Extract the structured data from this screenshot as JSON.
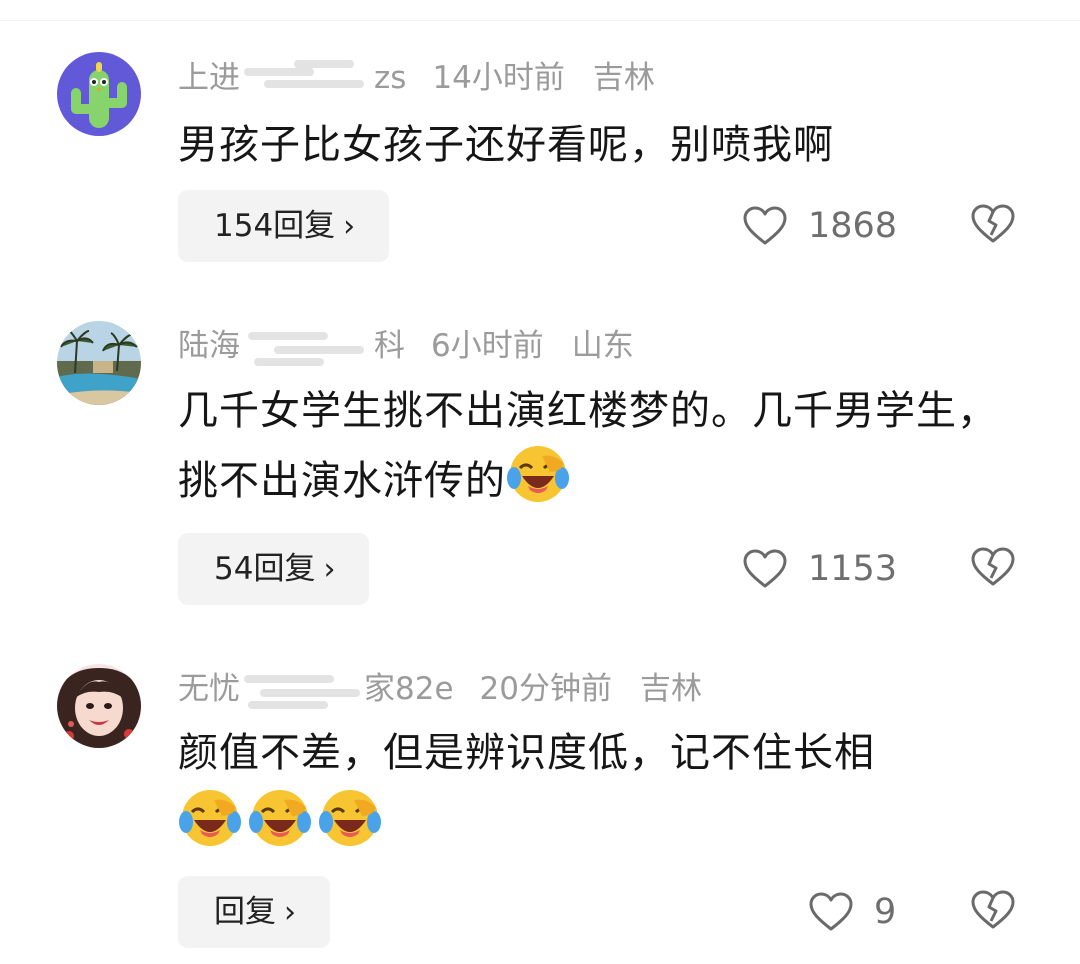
{
  "comments": [
    {
      "username_prefix": "上进",
      "username_suffix": "zs",
      "time": "14小时前",
      "location": "吉林",
      "text": "男孩子比女孩子还好看呢，别喷我啊",
      "reply_label": "154回复",
      "likes": "1868",
      "avatar": "cactus-avatar"
    },
    {
      "username_prefix": "陆海",
      "username_suffix": "科",
      "time": "6小时前",
      "location": "山东",
      "text": "几千女学生挑不出演红楼梦的。几千男学生，挑不出演水浒传的",
      "reply_label": "54回复",
      "likes": "1153",
      "avatar": "landscape-avatar"
    },
    {
      "username_prefix": "无忧",
      "username_suffix": "家82e",
      "time": "20分钟前",
      "location": "吉林",
      "text": "颜值不差，但是辨识度低，记不住长相",
      "reply_label": "回复",
      "likes": "9",
      "avatar": "girl-avatar"
    }
  ],
  "icons": {
    "like": "heart-outline-icon",
    "dislike": "broken-heart-icon",
    "emoji": "laugh-cry-emoji",
    "chevron": "chevron-right-icon"
  },
  "colors": {
    "meta_text": "#9b9b9b",
    "reply_bg": "#f3f3f3",
    "emoji_yellow": "#f7c531"
  }
}
